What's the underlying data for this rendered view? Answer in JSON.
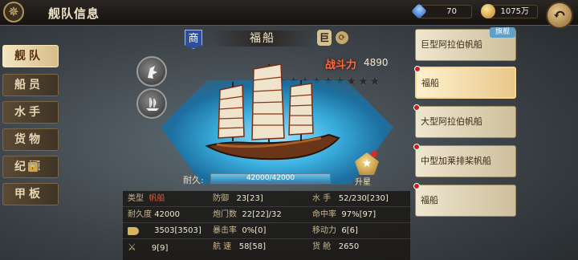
{
  "header": {
    "title": "舰队信息",
    "gems": "70",
    "gold": "1075万",
    "back_label": "↶"
  },
  "tabs": [
    {
      "label": "舰队",
      "active": true
    },
    {
      "label": "船员",
      "active": false
    },
    {
      "label": "水手",
      "active": false
    },
    {
      "label": "货物",
      "active": false
    },
    {
      "label": "纪源",
      "active": false
    },
    {
      "label": "甲板",
      "active": false
    }
  ],
  "ship": {
    "type_badge": "商",
    "name": "福船",
    "size_badge": "巨",
    "power_label": "战斗力",
    "power_value": "4890",
    "stars_total": 10,
    "stars_lit": 1,
    "durability_label": "耐久:",
    "durability_text": "42000/42000",
    "durability_fraction": 1.0,
    "star_up_label": "升星"
  },
  "stats": [
    {
      "label": "类型",
      "value": "帆船",
      "red": true
    },
    {
      "label": "防御",
      "value": "23[23]"
    },
    {
      "label": "水 手",
      "value": "52/230[230]"
    },
    {
      "label": "耐久度",
      "value": "42000"
    },
    {
      "label": "炮门数",
      "value": "22[22]/32"
    },
    {
      "label": "命中率",
      "value": "97%[97]"
    },
    {
      "label": "cannon-icon",
      "value": "3503[3503]"
    },
    {
      "label": "暴击率",
      "value": "0%[0]"
    },
    {
      "label": "移动力",
      "value": "6[6]"
    },
    {
      "label": "swords-icon",
      "value": "9[9]"
    },
    {
      "label": "航 速",
      "value": "58[58]"
    },
    {
      "label": "货 舱",
      "value": "2650"
    }
  ],
  "fleet": [
    {
      "name": "巨型阿拉伯帆船",
      "flag": "旗舰",
      "dot": false,
      "active": false
    },
    {
      "name": "福船",
      "dot": true,
      "active": true
    },
    {
      "name": "大型阿拉伯帆船",
      "dot": true,
      "active": false
    },
    {
      "name": "中型加莱排桨帆船",
      "dot": true,
      "active": false
    },
    {
      "name": "福船",
      "dot": true,
      "active": false
    }
  ]
}
